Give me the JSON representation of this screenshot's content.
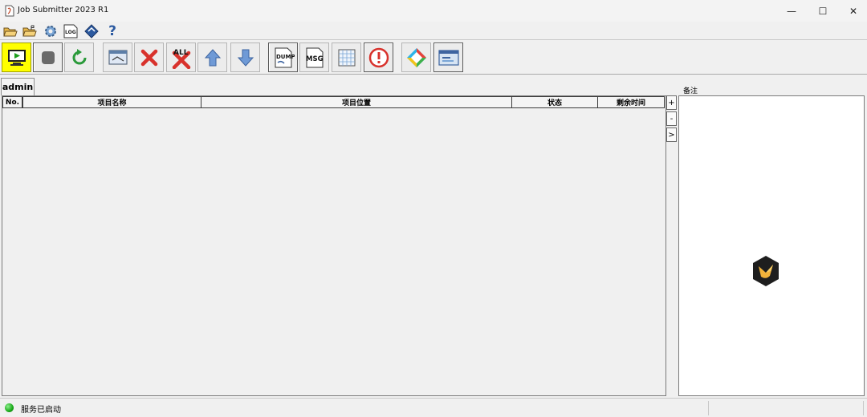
{
  "window": {
    "title": "Job Submitter 2023 R1",
    "minimize": "—",
    "maximize": "☐",
    "close": "✕"
  },
  "menubar": {
    "icons": [
      "open-folder-icon",
      "open-recent-folder-icon",
      "settings-gear-icon",
      "log-icon",
      "help-book-icon",
      "question-icon"
    ],
    "log_label": "LOG",
    "help_label": "?"
  },
  "toolbar": {
    "all_label": "ALL",
    "dump_label": "DUMP",
    "msg_label": "MSG",
    "accent": "#ffff00"
  },
  "tabs": [
    {
      "label": "admin"
    }
  ],
  "table": {
    "columns": [
      "No.",
      "项目名称",
      "项目位置",
      "状态",
      "剩余时间"
    ],
    "rows": []
  },
  "side_buttons": [
    "+",
    "-",
    ">"
  ],
  "notes": {
    "label": "备注"
  },
  "status": {
    "text": "服务已启动",
    "color": "#18a818"
  }
}
